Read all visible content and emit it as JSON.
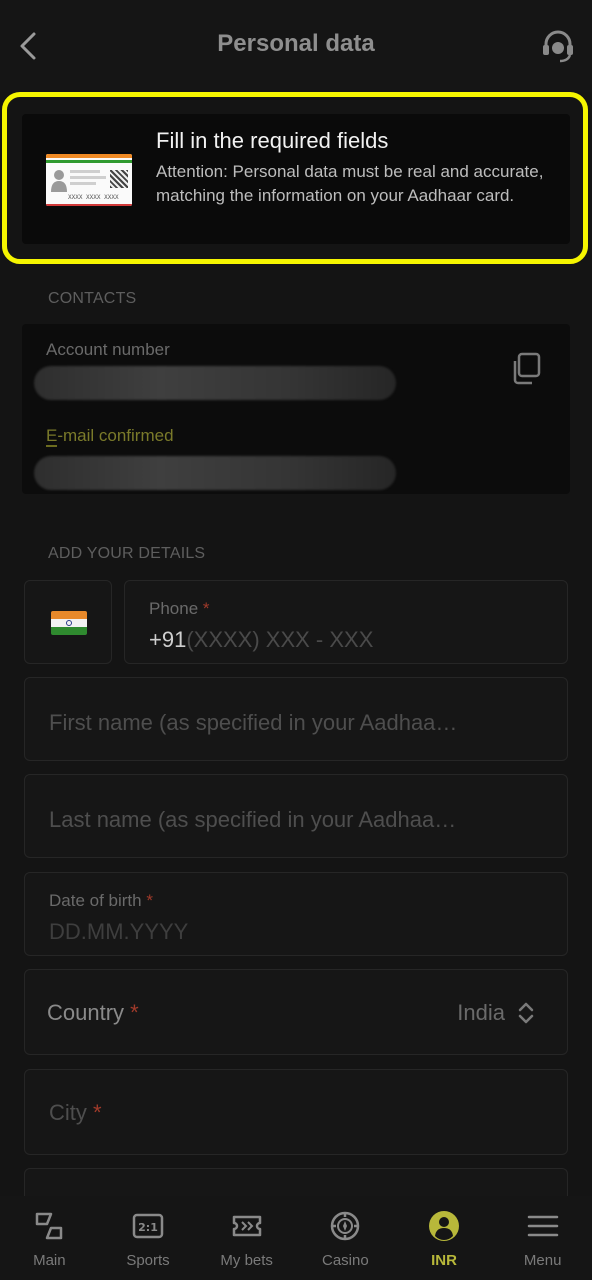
{
  "header": {
    "title": "Personal data"
  },
  "notice": {
    "title": "Fill in the required fields",
    "text": "Attention: Personal data must be real and accurate, matching the information on your Aadhaar card.",
    "card_number": "XXXX XXXX XXXX"
  },
  "contacts": {
    "section_label": "CONTACTS",
    "account_label": "Account number",
    "email_label_first": "E",
    "email_label_rest": "-mail confirmed"
  },
  "details": {
    "section_label": "ADD YOUR DETAILS",
    "phone_label": "Phone",
    "phone_prefix": "+91",
    "phone_placeholder": "(XXXX) XXX - XXX",
    "first_name_placeholder": "First name (as specified in your Aadhaa…",
    "last_name_placeholder": "Last name (as specified in your Aadhaa…",
    "dob_label": "Date of birth",
    "dob_placeholder": "DD.MM.YYYY",
    "country_label": "Country",
    "country_value": "India",
    "city_label": "City",
    "required_mark": "*"
  },
  "nav": {
    "items": [
      {
        "label": "Main",
        "icon": "main-icon"
      },
      {
        "label": "Sports",
        "icon": "sports-icon"
      },
      {
        "label": "My bets",
        "icon": "ticket-icon"
      },
      {
        "label": "Casino",
        "icon": "casino-chip-icon"
      },
      {
        "label": "INR",
        "icon": "account-icon",
        "active": true
      },
      {
        "label": "Menu",
        "icon": "menu-icon"
      }
    ]
  },
  "colors": {
    "highlight": "#f5f500",
    "accent": "#b8b83a",
    "required": "#a03a2a"
  }
}
